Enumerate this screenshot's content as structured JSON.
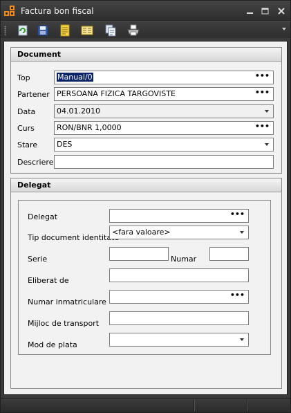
{
  "window": {
    "title": "Factura bon fiscal",
    "icons": {
      "app": "app-logo-icon",
      "minimize": "minimize-icon",
      "maximize": "maximize-icon",
      "close": "close-icon"
    }
  },
  "toolbar": {
    "buttons": [
      {
        "name": "refresh",
        "icon": "refresh-icon"
      },
      {
        "name": "save",
        "icon": "save-icon"
      },
      {
        "name": "document",
        "icon": "document-icon"
      },
      {
        "name": "notes",
        "icon": "notes-icon"
      },
      {
        "name": "copy",
        "icon": "copy-icon"
      },
      {
        "name": "print",
        "icon": "print-icon"
      }
    ],
    "overflow_icon": "chevron-down-icon"
  },
  "document": {
    "title": "Document",
    "top_label": "Top",
    "top_value": "Manual/0",
    "partener_label": "Partener",
    "partener_value": "PERSOANA FIZICA TARGOVISTE",
    "data_label": "Data",
    "data_value": "04.01.2010",
    "curs_label": "Curs",
    "curs_value": "RON/BNR 1,0000",
    "stare_label": "Stare",
    "stare_value": "DES",
    "descriere_label": "Descriere",
    "descriere_value": ""
  },
  "delegat": {
    "title": "Delegat",
    "delegat_label": "Delegat",
    "delegat_value": "",
    "tip_label": "Tip document identitate",
    "tip_value": "<fara valoare>",
    "serie_label": "Serie",
    "serie_value": "",
    "numar_label": "Numar",
    "numar_value": "",
    "eliberat_label": "Eliberat de",
    "eliberat_value": "",
    "inmatriculare_label": "Numar inmatriculare",
    "inmatriculare_value": "",
    "mijloc_label": "Mijloc de transport",
    "mijloc_value": "",
    "plata_label": "Mod de plata",
    "plata_value": ""
  },
  "ellipsis": "•••",
  "colors": {
    "chrome": "#3b3b3b",
    "panel": "#f2f2f2",
    "selection": "#0a246a"
  }
}
